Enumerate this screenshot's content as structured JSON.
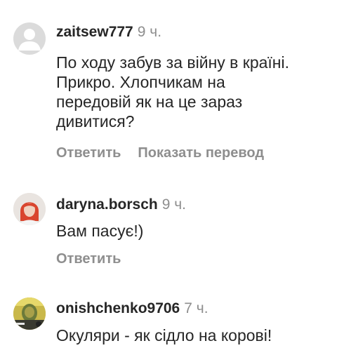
{
  "comments": [
    {
      "avatar_icon": "default-user-avatar-icon",
      "username": "zaitsew777",
      "time": "9 ч.",
      "lines": [
        "По ходу забув за війну в країні.",
        "Прикро. Хлопчикам на",
        "передовій як на це зараз",
        "дивитися?"
      ],
      "reply_label": "Ответить",
      "translate_label": "Показать перевод"
    },
    {
      "avatar_icon": "red-haired-woman-avatar",
      "username": "daryna.borsch",
      "time": "9 ч.",
      "lines": [
        "Вам пасує!)"
      ],
      "reply_label": "Ответить"
    },
    {
      "avatar_icon": "yellow-profile-photo-avatar",
      "username": "onishchenko9706",
      "time": "7 ч.",
      "lines": [
        "Окуляри - як сідло на корові!"
      ]
    }
  ],
  "colors": {
    "text": "#262626",
    "secondary": "#8e8e8e",
    "default_avatar_bg": "#dbdbdb"
  }
}
